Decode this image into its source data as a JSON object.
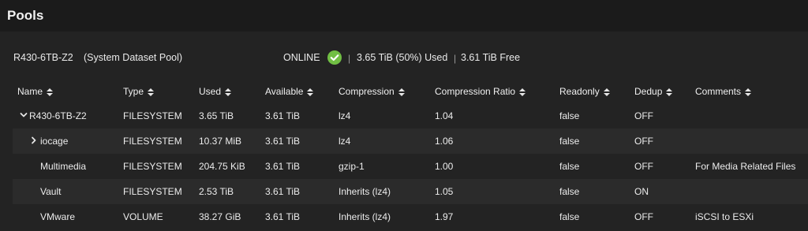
{
  "page": {
    "title": "Pools"
  },
  "pool": {
    "name": "R430-6TB-Z2",
    "role": "(System Dataset Pool)",
    "status": "ONLINE",
    "used": "3.65 TiB (50%) Used",
    "free": "3.61 TiB Free",
    "separator": "|",
    "status_color": "#71bf44"
  },
  "table": {
    "columns": [
      "Name",
      "Type",
      "Used",
      "Available",
      "Compression",
      "Compression Ratio",
      "Readonly",
      "Dedup",
      "Comments"
    ],
    "rows": [
      {
        "name": "R430-6TB-Z2",
        "expander": "chevron-down-icon",
        "type": "FILESYSTEM",
        "used": "3.65 TiB",
        "available": "3.61 TiB",
        "compression": "lz4",
        "ratio": "1.04",
        "readonly": "false",
        "dedup": "OFF",
        "comments": ""
      },
      {
        "name": "iocage",
        "expander": "chevron-right-icon",
        "type": "FILESYSTEM",
        "used": "10.37 MiB",
        "available": "3.61 TiB",
        "compression": "lz4",
        "ratio": "1.06",
        "readonly": "false",
        "dedup": "OFF",
        "comments": ""
      },
      {
        "name": "Multimedia",
        "expander": "",
        "type": "FILESYSTEM",
        "used": "204.75 KiB",
        "available": "3.61 TiB",
        "compression": "gzip-1",
        "ratio": "1.00",
        "readonly": "false",
        "dedup": "OFF",
        "comments": "For Media Related Files"
      },
      {
        "name": "Vault",
        "expander": "",
        "type": "FILESYSTEM",
        "used": "2.53 TiB",
        "available": "3.61 TiB",
        "compression": "Inherits (lz4)",
        "ratio": "1.05",
        "readonly": "false",
        "dedup": "ON",
        "comments": ""
      },
      {
        "name": "VMware",
        "expander": "",
        "type": "VOLUME",
        "used": "38.27 GiB",
        "available": "3.61 TiB",
        "compression": "Inherits (lz4)",
        "ratio": "1.97",
        "readonly": "false",
        "dedup": "OFF",
        "comments": "iSCSI to ESXi"
      }
    ]
  },
  "colors": {
    "background": "#1b1b1b",
    "card": "#232323",
    "alt_row": "#2b2b2b",
    "text": "#e9e9e9"
  }
}
